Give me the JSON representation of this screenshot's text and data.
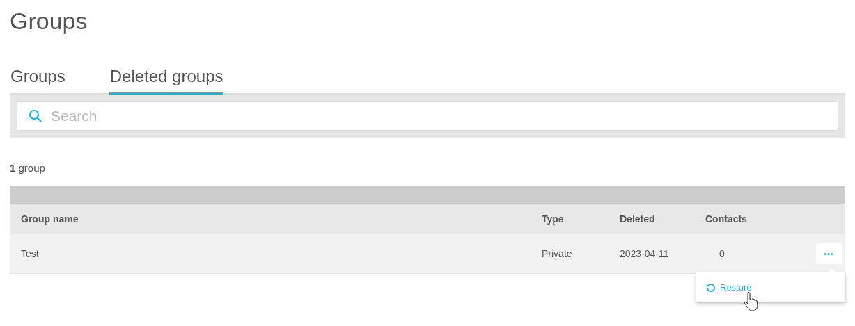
{
  "page_title": "Groups",
  "tabs": [
    {
      "label": "Groups",
      "selected": false
    },
    {
      "label": "Deleted groups",
      "selected": true
    }
  ],
  "search": {
    "placeholder": "Search"
  },
  "result_count": "**1** group",
  "table": {
    "columns": [
      "Group name",
      "Type",
      "Deleted",
      "Contacts"
    ],
    "rows": [
      {
        "cells": [
          "Test",
          "Private",
          "2023-04-11",
          "0"
        ],
        "menu_open": true
      }
    ]
  },
  "row_menu": {
    "button": "•••",
    "items": [
      {
        "label": "Restore"
      }
    ]
  }
}
